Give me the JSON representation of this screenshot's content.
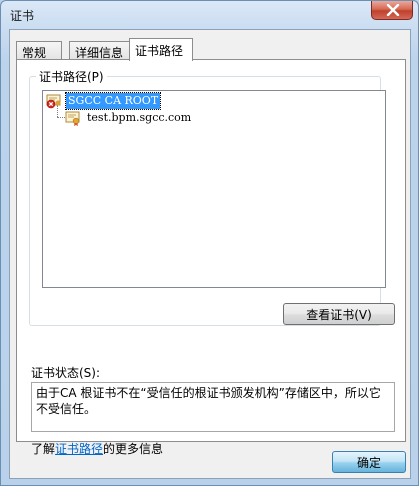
{
  "window": {
    "title": "证书"
  },
  "tabs": [
    {
      "label": "常规"
    },
    {
      "label": "详细信息"
    },
    {
      "label": "证书路径"
    }
  ],
  "cert_path": {
    "group_label": "证书路径(P)",
    "items": [
      {
        "label": "SGCC CA ROOT",
        "icon": "cert-error-icon",
        "selected": true
      },
      {
        "label": "test.bpm.sgcc.com",
        "icon": "cert-icon",
        "selected": false
      }
    ],
    "view_button": "查看证书(V)"
  },
  "status": {
    "label": "证书状态(S):",
    "text": "由于CA 根证书不在“受信任的根证书颁发机构”存储区中，所以它不受信任。"
  },
  "learn_more": {
    "prefix": "了解",
    "link": "证书路径",
    "suffix": "的更多信息"
  },
  "footer": {
    "ok_button": "确定"
  },
  "colors": {
    "selection": "#3399ff",
    "link": "#0066cc",
    "close_button": "#c0402a"
  }
}
